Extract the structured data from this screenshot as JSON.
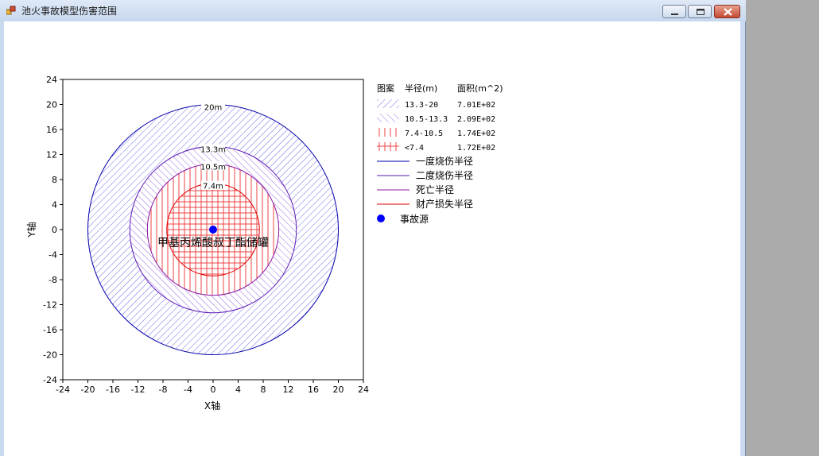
{
  "window": {
    "title": "池火事故模型伤害范围",
    "controls": [
      "minimize-icon",
      "maximize-icon",
      "close-icon"
    ]
  },
  "colors": {
    "dark_blue": "#0000a8",
    "purple_blue": "#5a1ab4",
    "purple": "#8a14a0",
    "red": "#e00000",
    "hatch_blue": "#6a6af0",
    "hatch_purple": "#9a6ae6",
    "grid_red": "#ee4444",
    "source": "#0000ff"
  },
  "chart_data": {
    "type": "scatter",
    "xlabel": "X轴",
    "ylabel": "Y轴",
    "xlim": [
      -24,
      24
    ],
    "ylim": [
      -24,
      24
    ],
    "xticks": [
      "-24",
      "-20",
      "-16",
      "-12",
      "-8",
      "-4",
      "0",
      "4",
      "8",
      "12",
      "16",
      "20",
      "24"
    ],
    "yticks": [
      "24",
      "20",
      "16",
      "12",
      "8",
      "4",
      "0",
      "-4",
      "-8",
      "-12",
      "-16",
      "-20",
      "-24"
    ],
    "grid": false,
    "legend_position": "right",
    "source_point": {
      "x": 0,
      "y": 0,
      "label": "甲基丙烯酸叔丁酯储罐"
    },
    "circles": [
      {
        "radius": 20,
        "label": "20m",
        "color": "#0000a8"
      },
      {
        "radius": 13.3,
        "label": "13.3m",
        "color": "#5a1ab4"
      },
      {
        "radius": 10.5,
        "label": "10.5m",
        "color": "#8a14a0"
      },
      {
        "radius": 7.4,
        "label": "7.4m",
        "color": "#e00000"
      }
    ],
    "legend": {
      "headers": [
        "图案",
        "半径(m)",
        "面积(m^2)"
      ],
      "zones": [
        {
          "range": "13.3-20",
          "area": "7.01E+02",
          "pattern": "diagonal-hatch"
        },
        {
          "range": "10.5-13.3",
          "area": "2.09E+02",
          "pattern": "diagonal-hatch-purple"
        },
        {
          "range": "7.4-10.5",
          "area": "1.74E+02",
          "pattern": "vertical-hatch"
        },
        {
          "range": "<7.4",
          "area": "1.72E+02",
          "pattern": "grid-hatch"
        }
      ],
      "lines": [
        {
          "label": "一度烧伤半径",
          "color": "#0000a8"
        },
        {
          "label": "二度烧伤半径",
          "color": "#5a1ab4"
        },
        {
          "label": "死亡半径",
          "color": "#8a14a0"
        },
        {
          "label": "财产损失半径",
          "color": "#e00000"
        }
      ],
      "source_label": "事故源"
    }
  }
}
